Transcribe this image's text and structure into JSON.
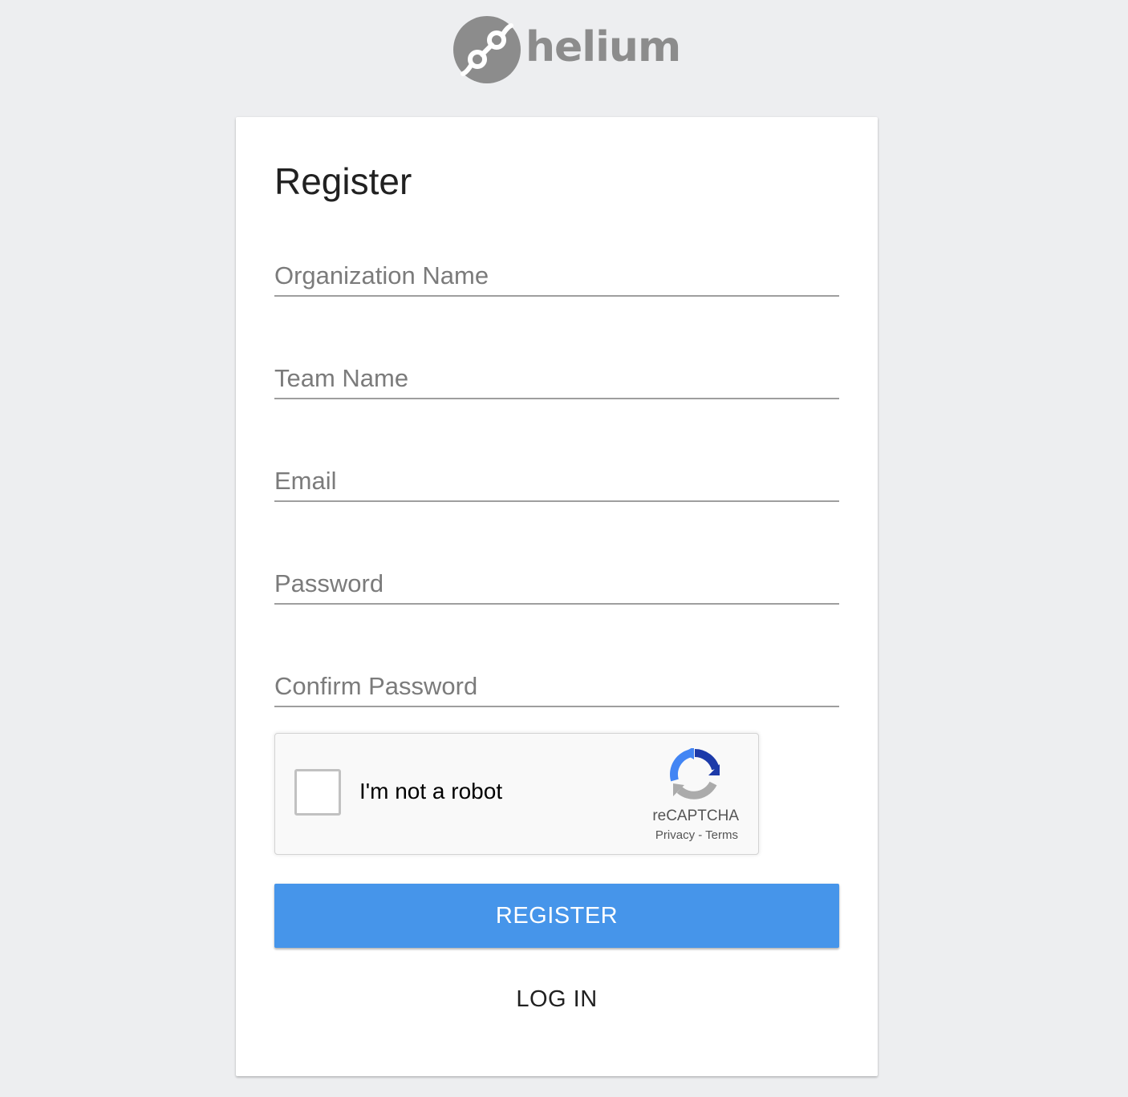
{
  "brand": {
    "name": "helium",
    "logo_icon": "helium-logo-icon"
  },
  "form": {
    "title": "Register",
    "fields": [
      {
        "id": "organization",
        "placeholder": "Organization Name",
        "value": ""
      },
      {
        "id": "team",
        "placeholder": "Team Name",
        "value": ""
      },
      {
        "id": "email",
        "placeholder": "Email",
        "value": ""
      },
      {
        "id": "password",
        "placeholder": "Password",
        "value": ""
      },
      {
        "id": "confirm_password",
        "placeholder": "Confirm Password",
        "value": ""
      }
    ],
    "captcha": {
      "label": "I'm not a robot",
      "brand": "reCAPTCHA",
      "privacy": "Privacy",
      "separator": " - ",
      "terms": "Terms",
      "checked": false,
      "icon": "recaptcha-icon"
    },
    "register_label": "REGISTER",
    "login_label": "LOG IN"
  },
  "colors": {
    "background": "#edeef0",
    "primary_button": "#4695ea",
    "logo_gray": "#8c8c8c"
  }
}
